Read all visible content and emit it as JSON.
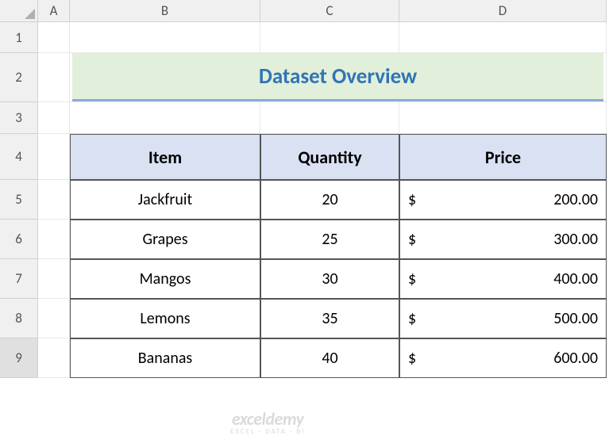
{
  "columns": [
    "A",
    "B",
    "C",
    "D"
  ],
  "rows": [
    "1",
    "2",
    "3",
    "4",
    "5",
    "6",
    "7",
    "8",
    "9"
  ],
  "selected_row": "9",
  "title": "Dataset Overview",
  "headers": {
    "item": "Item",
    "quantity": "Quantity",
    "price": "Price"
  },
  "data": [
    {
      "item": "Jackfruit",
      "quantity": "20",
      "price": "200.00"
    },
    {
      "item": "Grapes",
      "quantity": "25",
      "price": "300.00"
    },
    {
      "item": "Mangos",
      "quantity": "30",
      "price": "400.00"
    },
    {
      "item": "Lemons",
      "quantity": "35",
      "price": "500.00"
    },
    {
      "item": "Bananas",
      "quantity": "40",
      "price": "600.00"
    }
  ],
  "currency": "$",
  "watermark": {
    "line1": "exceldemy",
    "line2": "EXCEL · DATA · BI"
  }
}
